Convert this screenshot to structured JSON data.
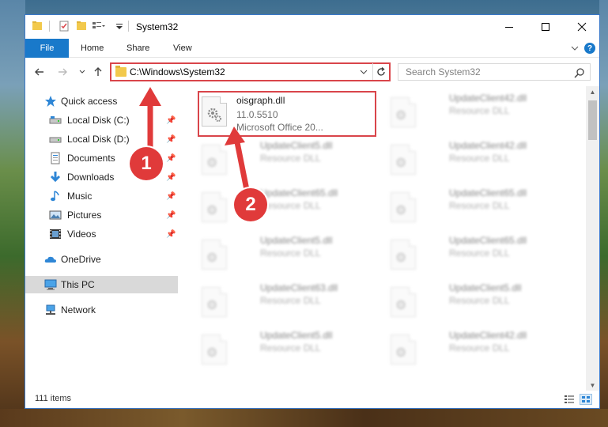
{
  "window": {
    "title": "System32"
  },
  "ribbon": {
    "file_tab": "File",
    "tabs": [
      "Home",
      "Share",
      "View"
    ],
    "help_label": "?"
  },
  "address": {
    "path": "C:\\Windows\\System32"
  },
  "search": {
    "placeholder": "Search System32"
  },
  "sidebar": {
    "items": [
      {
        "label": "Quick access",
        "icon": "star-icon"
      },
      {
        "label": "Local Disk (C:)",
        "icon": "drive-icon",
        "pinned": true
      },
      {
        "label": "Local Disk (D:)",
        "icon": "drive-icon",
        "pinned": true
      },
      {
        "label": "Documents",
        "icon": "documents-icon",
        "pinned": true
      },
      {
        "label": "Downloads",
        "icon": "download-icon",
        "pinned": true
      },
      {
        "label": "Music",
        "icon": "music-icon",
        "pinned": true
      },
      {
        "label": "Pictures",
        "icon": "pictures-icon",
        "pinned": true
      },
      {
        "label": "Videos",
        "icon": "videos-icon",
        "pinned": true
      },
      {
        "label": "OneDrive",
        "icon": "cloud-icon"
      },
      {
        "label": "This PC",
        "icon": "computer-icon",
        "selected": true
      },
      {
        "label": "Network",
        "icon": "network-icon"
      }
    ]
  },
  "files": {
    "highlighted": {
      "name": "oisgraph.dll",
      "version": "11.0.5510",
      "description": "Microsoft Office 20..."
    },
    "left_column": [
      {
        "name": "UpdateClient5.dll",
        "type": "Resource DLL"
      },
      {
        "name": "UpdateClient65.dll",
        "type": "Resource DLL"
      },
      {
        "name": "UpdateClient5.dll",
        "type": "Resource DLL"
      },
      {
        "name": "UpdateClient63.dll",
        "type": "Resource DLL"
      },
      {
        "name": "UpdateClient5.dll",
        "type": "Resource DLL"
      }
    ],
    "right_column": [
      {
        "name": "UpdateClient42.dll",
        "type": "Resource DLL"
      },
      {
        "name": "UpdateClient42.dll",
        "type": "Resource DLL"
      },
      {
        "name": "UpdateClient65.dll",
        "type": "Resource DLL"
      },
      {
        "name": "UpdateClient65.dll",
        "type": "Resource DLL"
      },
      {
        "name": "UpdateClient5.dll",
        "type": "Resource DLL"
      },
      {
        "name": "UpdateClient42.dll",
        "type": "Resource DLL"
      }
    ]
  },
  "status": {
    "item_count": "111 items"
  },
  "annotations": {
    "badge_1": "1",
    "badge_2": "2"
  },
  "colors": {
    "accent": "#1979ca",
    "highlight_red": "#d9454a",
    "badge_red": "#e03a3a"
  }
}
